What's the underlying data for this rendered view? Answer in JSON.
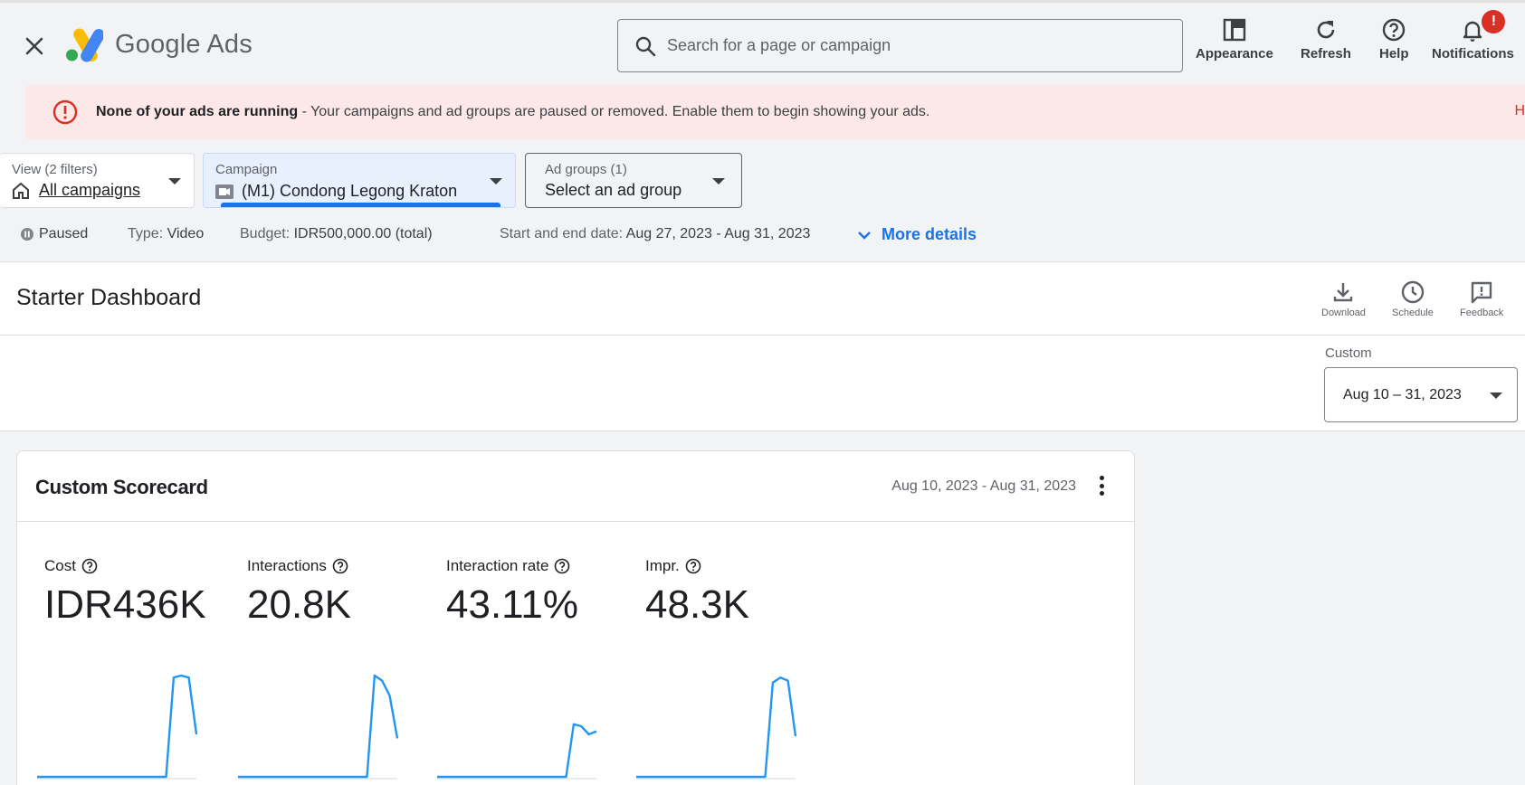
{
  "header": {
    "brand_google": "Google",
    "brand_ads": "Ads",
    "search_placeholder": "Search for a page or campaign",
    "tools": {
      "appearance": "Appearance",
      "refresh": "Refresh",
      "help": "Help",
      "notifications": "Notifications"
    },
    "notification_badge": "!"
  },
  "alert": {
    "title": "None of your ads are running",
    "message": " - Your campaigns and ad groups are paused or removed. Enable them to begin showing your ads.",
    "cut_text": "H"
  },
  "filters": {
    "view": {
      "label": "View (2 filters)",
      "value": "All campaigns"
    },
    "campaign": {
      "label": "Campaign",
      "value": "(M1) Condong Legong Kraton"
    },
    "ad_groups": {
      "label": "Ad groups (1)",
      "value": "Select an ad group"
    }
  },
  "campaign_details": {
    "status": "Paused",
    "type_key": "Type:",
    "type_value": "Video",
    "budget_key": "Budget:",
    "budget_value": "IDR500,000.00 (total)",
    "dates_key": "Start and end date:",
    "dates_value": "Aug 27, 2023 - Aug 31, 2023",
    "more_details": "More details"
  },
  "dashboard": {
    "title": "Starter Dashboard",
    "tools": {
      "download": "Download",
      "schedule": "Schedule",
      "feedback": "Feedback"
    },
    "date_label": "Custom",
    "date_value": "Aug 10 – 31, 2023"
  },
  "scorecard": {
    "title": "Custom Scorecard",
    "range": "Aug 10, 2023 - Aug 31, 2023",
    "metrics": [
      {
        "label": "Cost",
        "value": "IDR436K"
      },
      {
        "label": "Interactions",
        "value": "20.8K"
      },
      {
        "label": "Interaction rate",
        "value": "43.11%"
      },
      {
        "label": "Impr.",
        "value": "48.3K"
      }
    ]
  },
  "colors": {
    "accent": "#1a73e8",
    "alert_bg": "#fce8e6",
    "error": "#d93025",
    "spark": "#2196f3"
  },
  "chart_data": [
    {
      "type": "line",
      "series_of": "Cost",
      "values": [
        0,
        0,
        0,
        0,
        0,
        0,
        0,
        0,
        0,
        0,
        0,
        0,
        0,
        0,
        0,
        0,
        0,
        0,
        0.98,
        1,
        0.98,
        0.42
      ]
    },
    {
      "type": "line",
      "series_of": "Interactions",
      "values": [
        0,
        0,
        0,
        0,
        0,
        0,
        0,
        0,
        0,
        0,
        0,
        0,
        0,
        0,
        0,
        0,
        0,
        0,
        1,
        0.95,
        0.8,
        0.38
      ]
    },
    {
      "type": "line",
      "series_of": "Interaction rate",
      "values": [
        0,
        0,
        0,
        0,
        0,
        0,
        0,
        0,
        0,
        0,
        0,
        0,
        0,
        0,
        0,
        0,
        0,
        0,
        0.52,
        0.5,
        0.42,
        0.45
      ]
    },
    {
      "type": "line",
      "series_of": "Impr.",
      "values": [
        0,
        0,
        0,
        0,
        0,
        0,
        0,
        0,
        0,
        0,
        0,
        0,
        0,
        0,
        0,
        0,
        0,
        0,
        0.93,
        0.98,
        0.95,
        0.4
      ]
    }
  ]
}
